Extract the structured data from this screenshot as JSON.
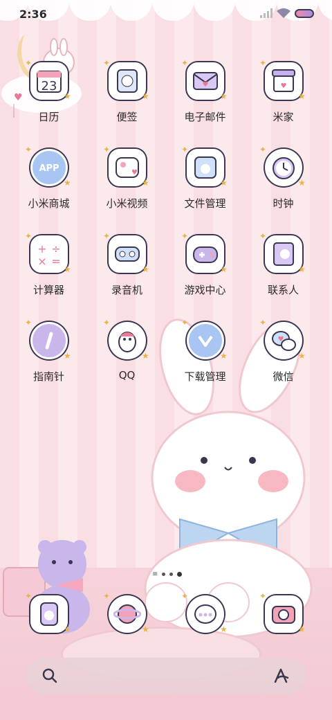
{
  "status_bar": {
    "time": "2:36"
  },
  "apps": [
    {
      "label": "日历",
      "icon": "calendar-icon",
      "badge": "23"
    },
    {
      "label": "便签",
      "icon": "notes-icon"
    },
    {
      "label": "电子邮件",
      "icon": "email-icon"
    },
    {
      "label": "米家",
      "icon": "mijia-icon"
    },
    {
      "label": "小米商城",
      "icon": "mi-store-icon",
      "badge": "APP"
    },
    {
      "label": "小米视频",
      "icon": "mi-video-icon"
    },
    {
      "label": "文件管理",
      "icon": "file-manager-icon"
    },
    {
      "label": "时钟",
      "icon": "clock-icon"
    },
    {
      "label": "计算器",
      "icon": "calculator-icon"
    },
    {
      "label": "录音机",
      "icon": "recorder-icon"
    },
    {
      "label": "游戏中心",
      "icon": "game-center-icon"
    },
    {
      "label": "联系人",
      "icon": "contacts-icon"
    },
    {
      "label": "指南针",
      "icon": "compass-icon"
    },
    {
      "label": "QQ",
      "icon": "qq-icon"
    },
    {
      "label": "下载管理",
      "icon": "downloads-icon"
    },
    {
      "label": "微信",
      "icon": "wechat-icon"
    }
  ],
  "dock": [
    {
      "icon": "phone-icon"
    },
    {
      "icon": "browser-icon"
    },
    {
      "icon": "messages-icon"
    },
    {
      "icon": "camera-icon"
    }
  ],
  "search": {
    "icon": "search-icon",
    "assistant_icon": "assistant-icon"
  },
  "colors": {
    "accent_pink": "#f08aa8",
    "accent_purple": "#a98ce0",
    "outline": "#3a3550"
  }
}
